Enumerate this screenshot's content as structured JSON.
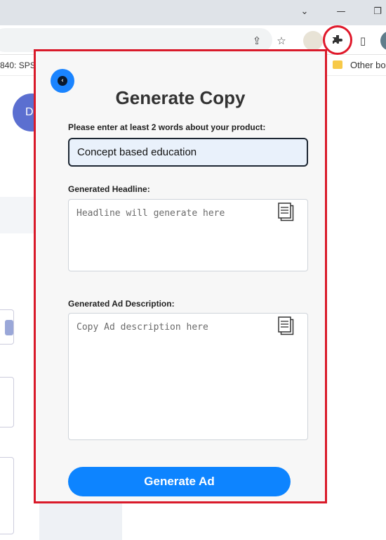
{
  "browser": {
    "titlebar": {
      "chevron_icon": "chevron-down-icon",
      "minimize_icon": "minimize-icon",
      "restore_icon": "restore-icon"
    },
    "toolbar": {
      "share_icon": "share-icon",
      "bookmark_star_icon": "star-icon",
      "extensions_icon": "puzzle-icon",
      "sidepanel_icon": "side-panel-icon"
    },
    "bookmarks": {
      "left_label": "840: SPS",
      "other_label": "Other bo"
    }
  },
  "background_page": {
    "avatar_initial": "D"
  },
  "popup": {
    "title": "Generate Copy",
    "product_prompt": "Please enter at least 2 words about your product:",
    "product_value": "Concept based education",
    "headline_label": "Generated Headline:",
    "headline_placeholder": "Headline will generate here",
    "description_label": "Generated Ad Description:",
    "description_placeholder": "Copy Ad description here",
    "generate_button": "Generate Ad"
  },
  "colors": {
    "accent_blue": "#0d84ff",
    "highlight_red": "#d91a2a",
    "popup_bg": "#f7f7f7"
  }
}
